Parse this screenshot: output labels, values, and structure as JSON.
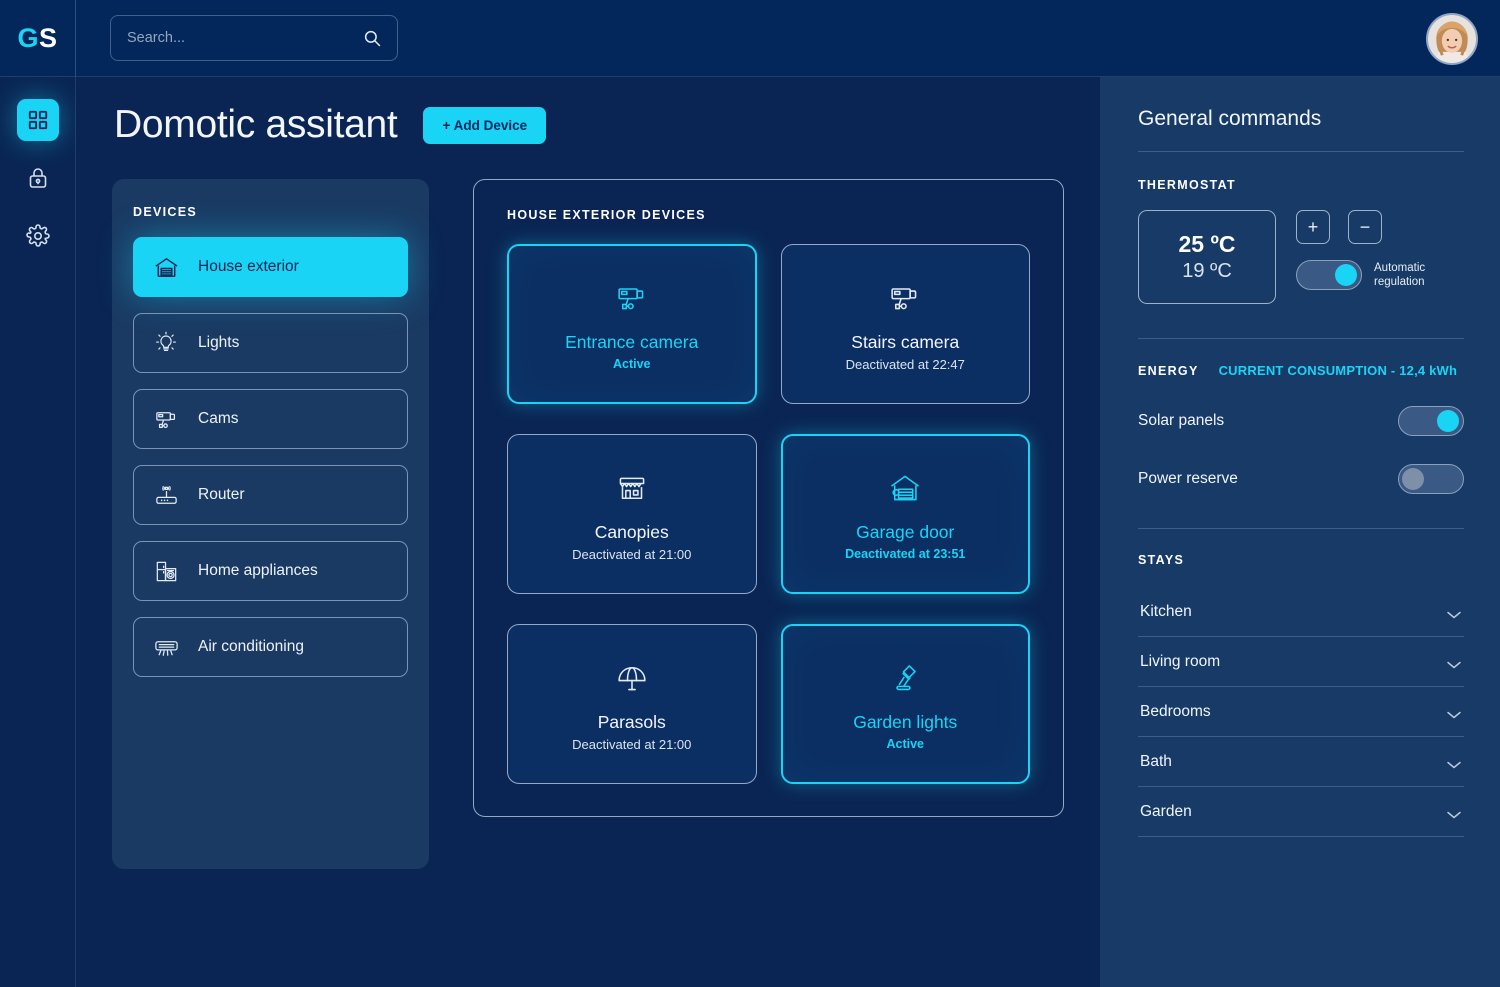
{
  "topbar": {
    "logo_first": "G",
    "logo_second": "S",
    "search_placeholder": "Search...",
    "search_value": "",
    "search_icon": "search-icon",
    "avatar_alt": "user-avatar"
  },
  "rail": {
    "items": [
      {
        "name": "dashboard",
        "icon": "grid-icon",
        "active": true
      },
      {
        "name": "security",
        "icon": "lock-icon",
        "active": false
      },
      {
        "name": "settings",
        "icon": "gear-icon",
        "active": false
      }
    ]
  },
  "page": {
    "title": "Domotic assitant",
    "add_device_label": "+ Add Device"
  },
  "devices_panel": {
    "heading": "DEVICES",
    "items": [
      {
        "label": "House exterior",
        "icon": "garage-icon",
        "active": true
      },
      {
        "label": "Lights",
        "icon": "bulb-icon",
        "active": false
      },
      {
        "label": "Cams",
        "icon": "camera-icon",
        "active": false
      },
      {
        "label": "Router",
        "icon": "router-icon",
        "active": false
      },
      {
        "label": "Home appliances",
        "icon": "appliance-icon",
        "active": false
      },
      {
        "label": "Air conditioning",
        "icon": "ac-icon",
        "active": false
      }
    ]
  },
  "exterior_panel": {
    "heading": "HOUSE EXTERIOR DEVICES",
    "cards": [
      {
        "name": "Entrance camera",
        "status": "Active",
        "icon": "camera-icon",
        "on": true
      },
      {
        "name": "Stairs camera",
        "status": "Deactivated at 22:47",
        "icon": "camera-icon",
        "on": false
      },
      {
        "name": "Canopies",
        "status": "Deactivated at 21:00",
        "icon": "awning-icon",
        "on": false
      },
      {
        "name": "Garage door",
        "status": "Deactivated at 23:51",
        "icon": "garage-icon",
        "on": true
      },
      {
        "name": "Parasols",
        "status": "Deactivated at 21:00",
        "icon": "parasol-icon",
        "on": false
      },
      {
        "name": "Garden lights",
        "status": "Active",
        "icon": "lamp-icon",
        "on": true
      }
    ]
  },
  "right_panel": {
    "title": "General commands",
    "thermostat": {
      "label": "THERMOSTAT",
      "target_temp": "25 ºC",
      "current_temp": "19 ºC",
      "increase_label": "+",
      "decrease_label": "−",
      "auto_label_line1": "Automatic",
      "auto_label_line2": "regulation",
      "auto_on": true
    },
    "energy": {
      "label": "ENERGY",
      "consumption": "CURRENT CONSUMPTION - 12,4 kWh",
      "rows": [
        {
          "label": "Solar panels",
          "on": true
        },
        {
          "label": "Power reserve",
          "on": false
        }
      ]
    },
    "stays": {
      "label": "STAYS",
      "items": [
        {
          "label": "Kitchen"
        },
        {
          "label": "Living room"
        },
        {
          "label": "Bedrooms"
        },
        {
          "label": "Bath"
        },
        {
          "label": "Garden"
        }
      ]
    }
  },
  "colors": {
    "accent": "#1ad4f5",
    "background": "#0a2553",
    "topbar": "#04275b",
    "panel": "#1a3a63",
    "right_panel": "#173a66",
    "card": "#0c2f63",
    "border": "#93a9c6"
  }
}
